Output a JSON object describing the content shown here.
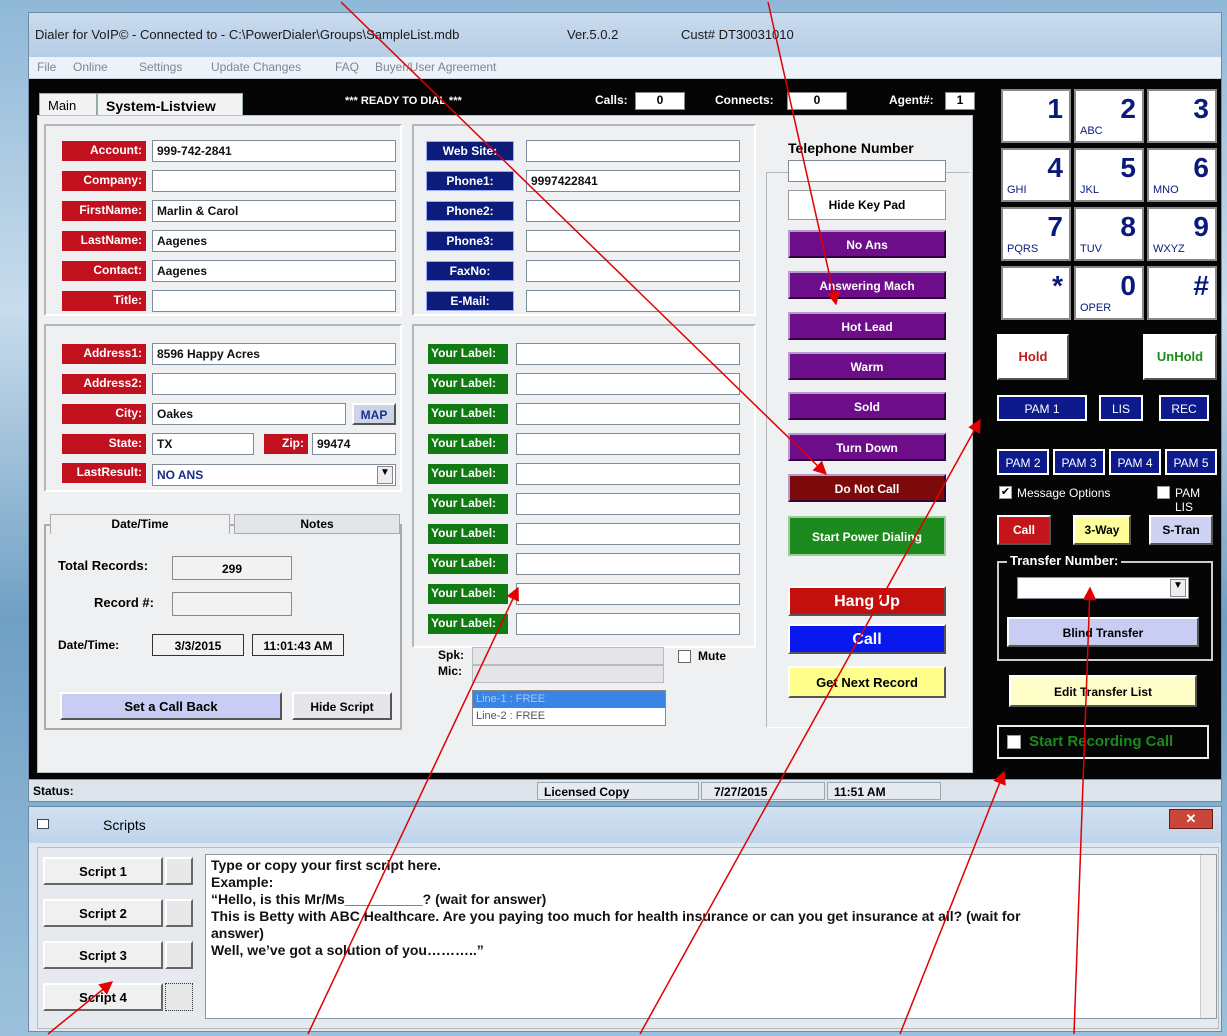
{
  "window": {
    "title": "Dialer for VoIP© - Connected to - C:\\PowerDialer\\Groups\\SampleList.mdb",
    "version": "Ver.5.0.2",
    "cust": "Cust# DT30031010"
  },
  "menu": [
    "File",
    "Online",
    "Settings",
    "Update Changes",
    "FAQ",
    "Buyer/User Agreement"
  ],
  "tabs": {
    "main": "Main",
    "listview": "System-Listview"
  },
  "status_top": {
    "ready": "*** READY TO DIAL ***",
    "calls_label": "Calls:",
    "calls_value": "0",
    "connects_label": "Connects:",
    "connects_value": "0",
    "agent_label": "Agent#:",
    "agent_value": "1"
  },
  "contact": {
    "account_label": "Account:",
    "account": "999-742-2841",
    "company_label": "Company:",
    "company": "",
    "firstname_label": "FirstName:",
    "firstname": "Marlin & Carol",
    "lastname_label": "LastName:",
    "lastname": "Aagenes",
    "contact_label": "Contact:",
    "contact": "Aagenes",
    "title_label": "Title:",
    "title": ""
  },
  "web": {
    "website_label": "Web Site:",
    "website": "",
    "phone1_label": "Phone1:",
    "phone1": "9997422841",
    "phone2_label": "Phone2:",
    "phone2": "",
    "phone3_label": "Phone3:",
    "phone3": "",
    "fax_label": "FaxNo:",
    "fax": "",
    "email_label": "E-Mail:",
    "email": ""
  },
  "address": {
    "address1_label": "Address1:",
    "address1": "8596 Happy Acres",
    "address2_label": "Address2:",
    "address2": "",
    "city_label": "City:",
    "city": "Oakes",
    "map_label": "MAP",
    "state_label": "State:",
    "state": "TX",
    "zip_label": "Zip:",
    "zip": "99474",
    "lastresult_label": "LastResult:",
    "lastresult": "NO ANS"
  },
  "your_label": "Your Label:",
  "datetime": {
    "tab_date": "Date/Time",
    "tab_notes": "Notes",
    "total_label": "Total Records:",
    "total": "299",
    "record_label": "Record #:",
    "record": "",
    "dt_label": "Date/Time:",
    "date": "3/3/2015",
    "time": "11:01:43 AM",
    "callback": "Set a Call Back",
    "hide_script": "Hide Script"
  },
  "audio": {
    "spk": "Spk:",
    "mic": "Mic:",
    "mute": "Mute",
    "line1": "Line-1 : FREE",
    "line2": "Line-2 : FREE"
  },
  "disposition": {
    "phone_title": "Telephone Number",
    "hide_keypad": "Hide Key Pad",
    "no_ans": "No Ans",
    "ans_mach": "Answering Mach",
    "hot_lead": "Hot Lead",
    "warm": "Warm",
    "sold": "Sold",
    "turn_down": "Turn Down",
    "dnc": "Do Not Call",
    "start": "Start Power Dialing",
    "hangup": "Hang Up",
    "call": "Call",
    "next": "Get Next Record"
  },
  "keypad": [
    {
      "n": "1",
      "l": ""
    },
    {
      "n": "2",
      "l": "ABC"
    },
    {
      "n": "3",
      "l": ""
    },
    {
      "n": "4",
      "l": "GHI"
    },
    {
      "n": "5",
      "l": "JKL"
    },
    {
      "n": "6",
      "l": "MNO"
    },
    {
      "n": "7",
      "l": "PQRS"
    },
    {
      "n": "8",
      "l": "TUV"
    },
    {
      "n": "9",
      "l": "WXYZ"
    },
    {
      "n": "*",
      "l": ""
    },
    {
      "n": "0",
      "l": "OPER"
    },
    {
      "n": "#",
      "l": ""
    }
  ],
  "right": {
    "hold": "Hold",
    "unhold": "UnHold",
    "pam1": "PAM 1",
    "lis": "LIS",
    "rec": "REC",
    "pam2": "PAM 2",
    "pam3": "PAM 3",
    "pam4": "PAM 4",
    "pam5": "PAM 5",
    "msg_opts": "Message Options",
    "pam_lis": "PAM LIS",
    "call": "Call",
    "three_way": "3-Way",
    "stran": "S-Tran",
    "transfer_label": "Transfer Number:",
    "blind": "Blind Transfer",
    "edit_list": "Edit Transfer List",
    "record": "Start Recording Call"
  },
  "statusbar": {
    "status": "Status:",
    "license": "Licensed Copy",
    "date": "7/27/2015",
    "time": "11:51 AM"
  },
  "scripts": {
    "title": "Scripts",
    "buttons": [
      "Script 1",
      "Script 2",
      "Script 3",
      "Script 4"
    ],
    "lines": [
      "Type or copy your first script here.",
      "Example:",
      "“Hello, is this Mr/Ms__________? (wait for answer)",
      "This is Betty with ABC Healthcare.  Are you paying too much for health insurance or can you get insurance at all?  (wait for",
      "answer)",
      "Well, we’ve got a solution of you………..”"
    ]
  },
  "colors": {
    "red": "#c1101e",
    "blue": "#0c1c7a",
    "green": "#127a12",
    "purple": "#6d0d8a",
    "arrow": "#e00000"
  }
}
